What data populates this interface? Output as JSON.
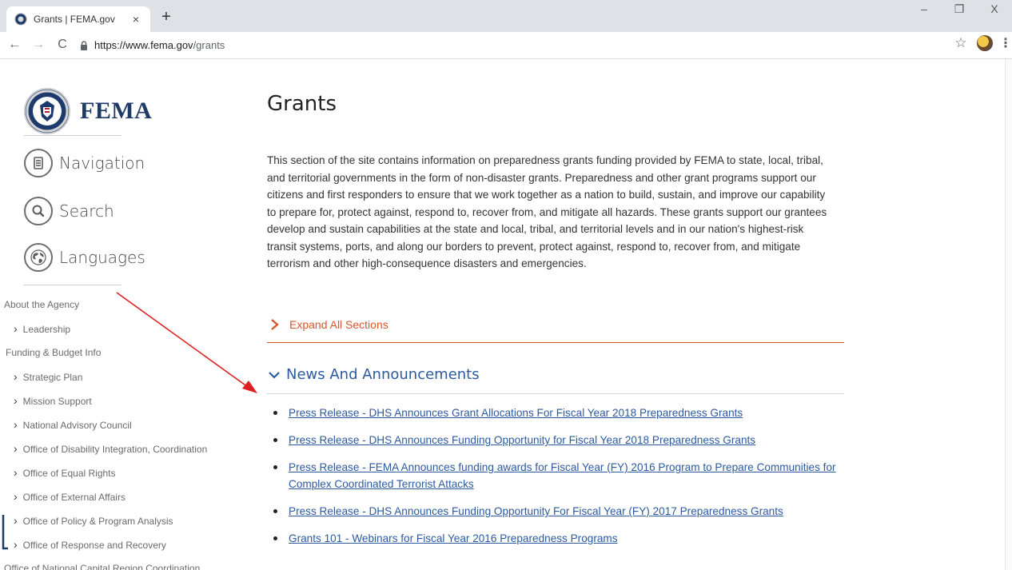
{
  "browser": {
    "tab_title": "Grants | FEMA.gov",
    "tab_close": "×",
    "new_tab": "+",
    "window_controls": {
      "minimize": "–",
      "restore": "❐",
      "close": "X"
    },
    "nav": {
      "back": "←",
      "forward": "→",
      "reload": "C"
    },
    "url_host": "https://www.fema.gov",
    "url_path": "/grants",
    "bookmark_icon": "☆",
    "menu_icon": "⋮"
  },
  "sidebar": {
    "logo_text": "FEMA",
    "menu": [
      {
        "label": "Navigation",
        "icon": "navigation-icon"
      },
      {
        "label": "Search",
        "icon": "search-icon"
      },
      {
        "label": "Languages",
        "icon": "globe-icon"
      }
    ],
    "links": [
      {
        "label": "About the Agency",
        "level": "parent"
      },
      {
        "label": "Leadership",
        "level": "child"
      },
      {
        "label": "Funding & Budget Info",
        "level": "parent"
      },
      {
        "label": "Strategic Plan",
        "level": "child"
      },
      {
        "label": "Mission Support",
        "level": "child"
      },
      {
        "label": "National Advisory Council",
        "level": "child"
      },
      {
        "label": "Office of Disability Integration, Coordination",
        "level": "child"
      },
      {
        "label": "Office of Equal Rights",
        "level": "child"
      },
      {
        "label": "Office of External Affairs",
        "level": "child"
      },
      {
        "label": "Office of Policy & Program Analysis",
        "level": "child"
      },
      {
        "label": "Office of Response and Recovery",
        "level": "child"
      },
      {
        "label": "Office of National Capital Region Coordination",
        "level": "parent"
      }
    ]
  },
  "main": {
    "title": "Grants",
    "intro": "This section of the site contains information on preparedness grants funding provided by FEMA to state, local, tribal, and territorial governments in the form of non-disaster grants. Preparedness and other grant programs support our citizens and first responders to ensure that we work together as a nation to build, sustain, and improve our capability to prepare for, protect against, respond to, recover from, and mitigate all hazards. These grants support our grantees develop and sustain capabilities at the state and local, tribal, and territorial levels and in our nation's highest-risk transit systems, ports, and along our borders to prevent, protect against, respond to, recover from, and mitigate terrorism and other high-consequence disasters and emergencies.",
    "expand_label": "Expand All Sections",
    "section_title": "News And Announcements",
    "news": [
      "Press Release - DHS Announces Grant Allocations For Fiscal Year 2018 Preparedness Grants",
      "Press Release - DHS Announces Funding Opportunity for Fiscal Year 2018 Preparedness Grants",
      "Press Release - FEMA Announces funding awards for Fiscal Year (FY) 2016 Program to Prepare Communities for Complex Coordinated Terrorist Attacks",
      "Press Release - DHS Announces Funding Opportunity For Fiscal Year (FY) 2017 Preparedness Grants",
      "Grants 101 - Webinars for Fiscal Year 2016 Preparedness Programs"
    ]
  },
  "colors": {
    "accent_orange": "#d9552b",
    "link_blue": "#2c5aa0",
    "fema_navy": "#1f3a67",
    "annotation_red": "#e02020"
  }
}
